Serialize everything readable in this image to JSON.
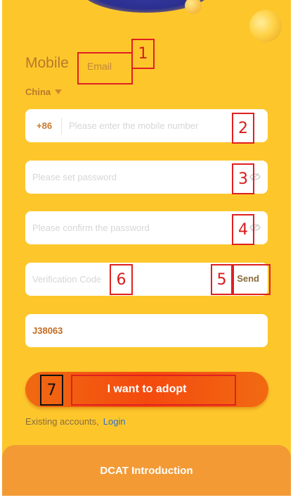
{
  "tabs": {
    "mobile": "Mobile",
    "email": "Email"
  },
  "country": {
    "label": "China"
  },
  "phone": {
    "prefix": "+86",
    "placeholder": "Please enter the mobile number"
  },
  "password": {
    "placeholder": "Please set password"
  },
  "confirm": {
    "placeholder": "Please confirm the password"
  },
  "verification": {
    "placeholder": "Verification Code",
    "send_label": "Send"
  },
  "invite_code": {
    "value": "J38063"
  },
  "adopt_button": {
    "label": "I want to adopt"
  },
  "existing": {
    "text": "Existing accounts,",
    "login_label": "Login"
  },
  "intro_label": "DCAT Introduction",
  "annotations": [
    "1",
    "2",
    "3",
    "4",
    "5",
    "6",
    "7"
  ],
  "colors": {
    "background": "#fdc72c",
    "button": "#f44a0e",
    "accent_text": "#b7782b",
    "link": "#2f6fd1",
    "annotation": "#e02020"
  }
}
